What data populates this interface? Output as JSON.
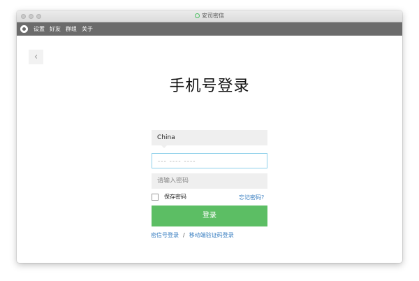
{
  "window": {
    "title": "安司密信"
  },
  "menu": {
    "items": [
      "设置",
      "好友",
      "群组",
      "关于"
    ]
  },
  "login": {
    "title": "手机号登录",
    "country": "China",
    "phone_placeholder": "--- ---- ----",
    "password_placeholder": "请输入密码",
    "remember_label": "保存密码",
    "forgot_label": "忘记密码?",
    "login_button": "登录",
    "alt_link_1": "密信号登录",
    "separator": "/",
    "alt_link_2": "移动端验证码登录"
  },
  "colors": {
    "accent": "#5cbe64",
    "link": "#3a7fc1",
    "menubar": "#6b6b6b"
  }
}
